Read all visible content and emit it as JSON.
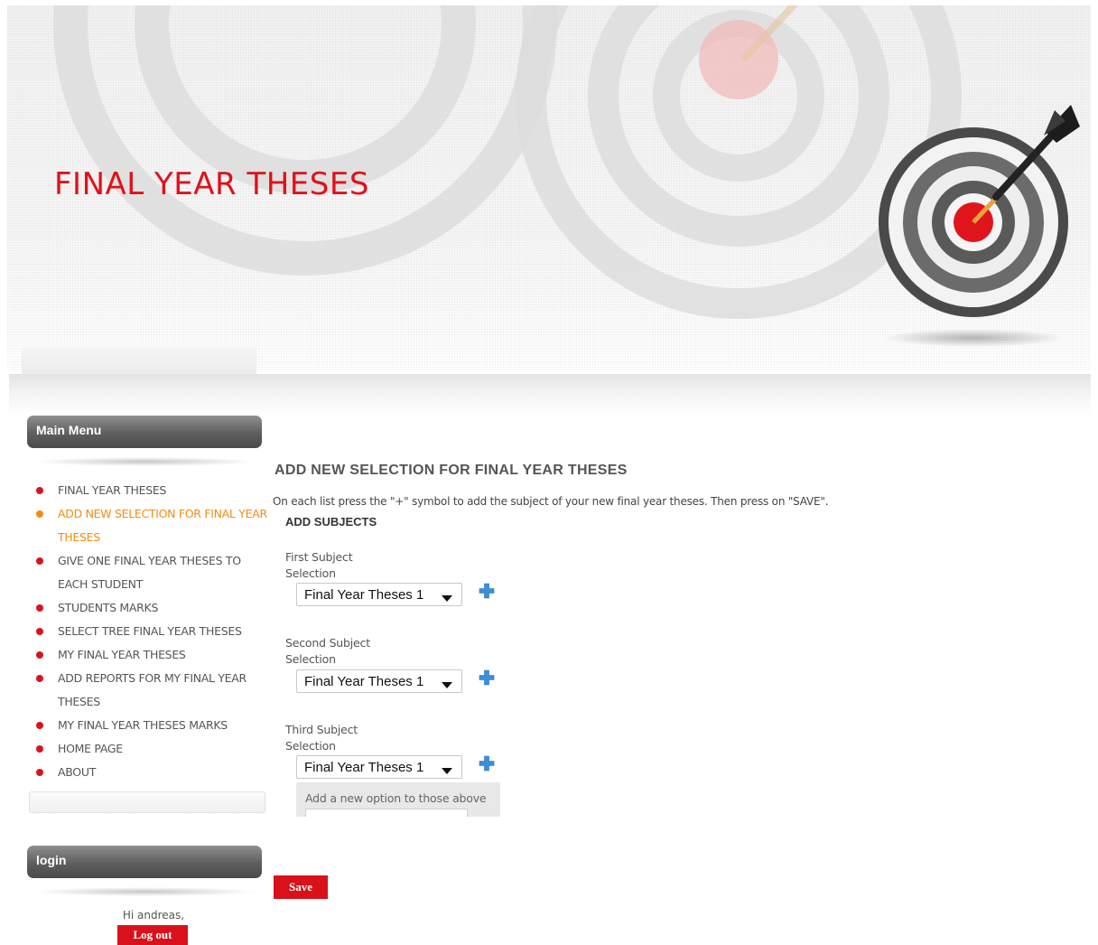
{
  "site": {
    "title": "FINAL YEAR THESES"
  },
  "colors": {
    "brand_red": "#e0111b",
    "active_orange": "#f18c14",
    "menu_block": "#5e5e5e"
  },
  "sidebar": {
    "main_menu_title": "Main Menu",
    "items": [
      {
        "label": "FINAL YEAR THESES",
        "active": false
      },
      {
        "label": "ADD NEW SELECTION FOR FINAL YEAR THESES",
        "active": true
      },
      {
        "label": "GIVE ONE FINAL YEAR THESES TO EACH STUDENT",
        "active": false
      },
      {
        "label": "STUDENTS MARKS",
        "active": false
      },
      {
        "label": "SELECT TREE FINAL YEAR THESES",
        "active": false
      },
      {
        "label": "MY FINAL YEAR THESES",
        "active": false
      },
      {
        "label": "ADD REPORTS FOR MY FINAL YEAR THESES",
        "active": false
      },
      {
        "label": "MY FINAL YEAR THESES MARKS",
        "active": false
      },
      {
        "label": "HOME PAGE",
        "active": false
      },
      {
        "label": "ABOUT",
        "active": false
      }
    ],
    "login_title": "login",
    "greeting": "Hi andreas,",
    "logout_label": "Log out"
  },
  "main": {
    "heading": "ADD NEW SELECTION FOR FINAL YEAR THESES",
    "instructions": "On each list press the \"+\" symbol to add the subject of your new final year theses. Then press on \"SAVE\".",
    "section_label": "ADD SUBJECTS",
    "fields": [
      {
        "label_line1": "First Subject",
        "label_line2": "Selection",
        "value": "Final Year Theses 1"
      },
      {
        "label_line1": "Second Subject",
        "label_line2": "Selection",
        "value": "Final Year Theses 1"
      },
      {
        "label_line1": "Third Subject",
        "label_line2": "Selection",
        "value": "Final Year Theses 1"
      }
    ],
    "add_option_label": "Add a new option to those above",
    "save_label": "Save"
  }
}
